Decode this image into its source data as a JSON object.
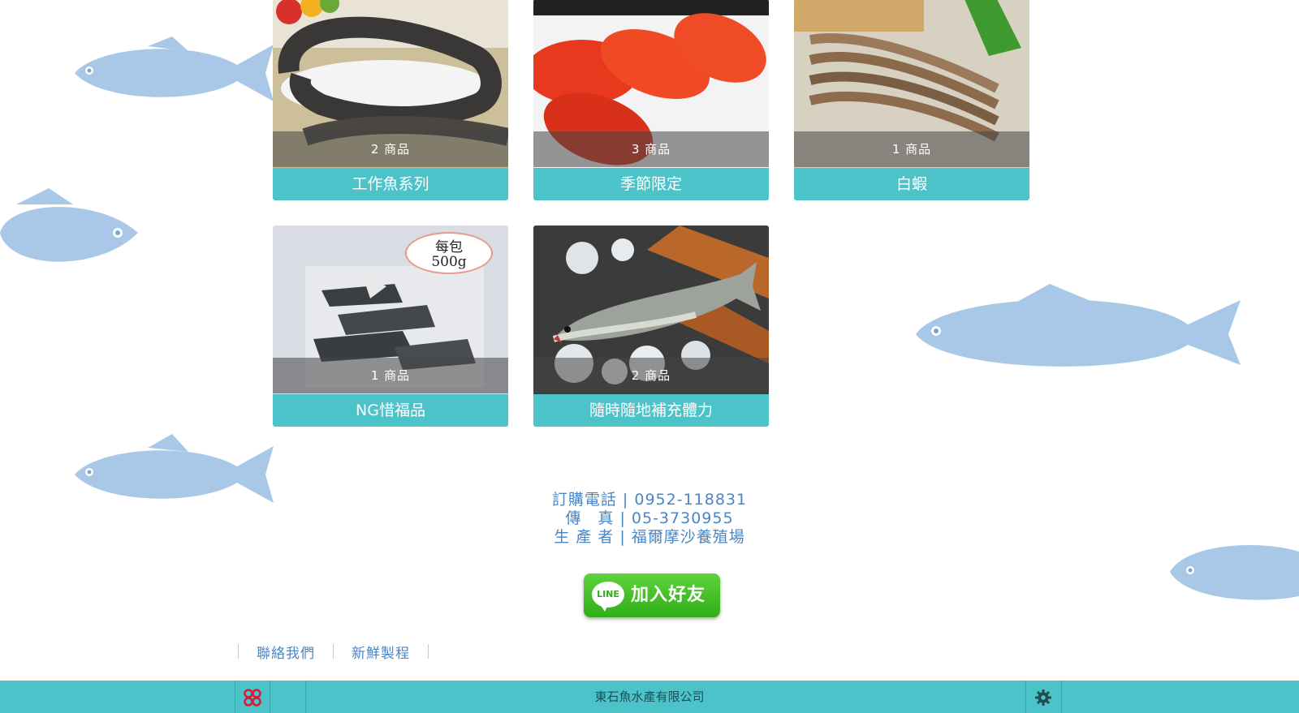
{
  "categories": [
    {
      "name": "工作魚系列",
      "count": "2 商品",
      "photo": "eel-photo"
    },
    {
      "name": "季節限定",
      "count": "3 商品",
      "photo": "roe-photo"
    },
    {
      "name": "白蝦",
      "count": "1 商品",
      "photo": "shrimp-photo"
    },
    {
      "name": "NG惜福品",
      "count": "1 商品",
      "photo": "fish-pack-photo",
      "tag": "每包\n500g"
    },
    {
      "name": "隨時隨地補充體力",
      "count": "2 商品",
      "photo": "seabass-photo"
    }
  ],
  "contact": {
    "phone": "訂購電話 | 0952-118831",
    "fax": "傳　真 | 05-3730955",
    "producer": "生 產 者 | 福爾摩沙養殖場"
  },
  "line_button": {
    "logo": "LINE",
    "label": "加入好友"
  },
  "footer_links": [
    "聯絡我們",
    "新鮮製程"
  ],
  "bottom_bar": {
    "company": "東石魚水產有限公司"
  },
  "colors": {
    "accent": "#4cc3c9",
    "link": "#4a86c5",
    "line_green": "#2fae1a"
  }
}
